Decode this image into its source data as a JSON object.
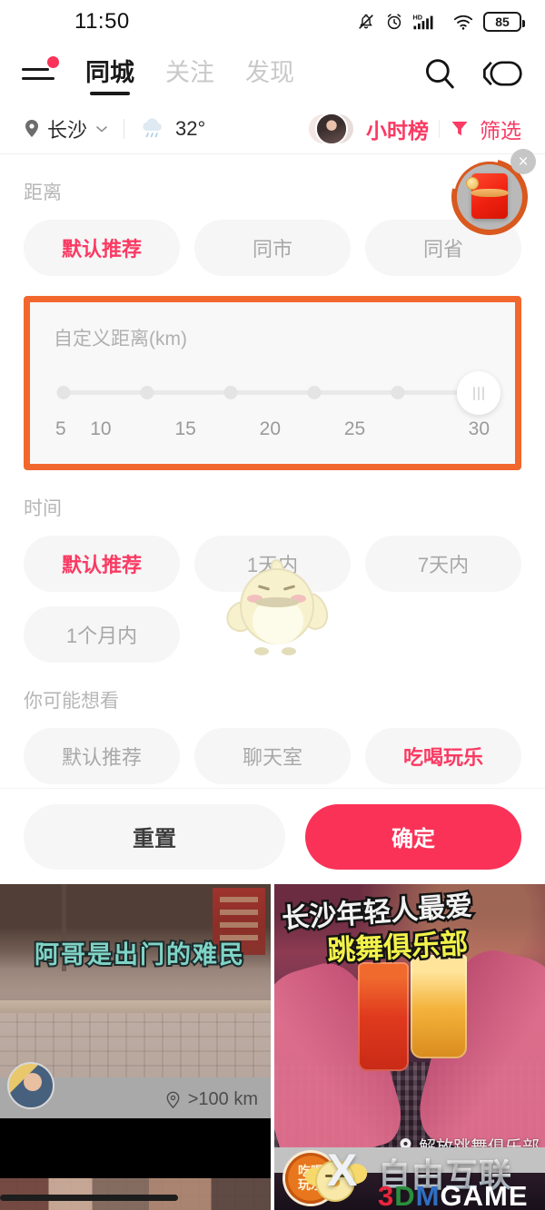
{
  "status_bar": {
    "time": "11:50",
    "battery_level": "85",
    "icons": [
      "bell-muted-icon",
      "alarm-icon",
      "hd-icon",
      "signal-icon",
      "wifi-icon",
      "battery-icon"
    ]
  },
  "top_nav": {
    "menu_icon": "hamburger-menu-icon",
    "has_badge": true,
    "tabs": [
      {
        "label": "同城",
        "active": true
      },
      {
        "label": "关注",
        "active": false
      },
      {
        "label": "发现",
        "active": false
      }
    ],
    "search_icon": "search-icon",
    "live_icon": "live-video-icon"
  },
  "location_bar": {
    "pin_icon": "location-pin-icon",
    "city": "长沙",
    "chevron_icon": "chevron-down-icon",
    "weather_icon": "rain-cloud-icon",
    "temperature": "32°",
    "hot_list_label": "小时榜",
    "filter_icon": "funnel-icon",
    "filter_label": "筛选"
  },
  "floating_packet": {
    "name": "red-packet-icon",
    "close_icon": "close-icon",
    "ring_color": "#d9591f",
    "packet_color": "#ef2010"
  },
  "filter_panel": {
    "distance": {
      "title": "距离",
      "options": [
        {
          "label": "默认推荐",
          "selected": true
        },
        {
          "label": "同市",
          "selected": false
        },
        {
          "label": "同省",
          "selected": false
        }
      ]
    },
    "custom_distance": {
      "label": "自定义距离(km)",
      "ticks": [
        "5",
        "10",
        "15",
        "20",
        "25",
        "30"
      ],
      "value": "30",
      "highlight_color": "#f2672e",
      "thumb_icon": "slider-handle-icon"
    },
    "time": {
      "title": "时间",
      "options": [
        {
          "label": "默认推荐",
          "selected": true
        },
        {
          "label": "1天内",
          "selected": false
        },
        {
          "label": "7天内",
          "selected": false
        },
        {
          "label": "1个月内",
          "selected": false
        }
      ]
    },
    "interests": {
      "title": "你可能想看",
      "options": [
        {
          "label": "默认推荐",
          "selected": false
        },
        {
          "label": "聊天室",
          "selected": false
        },
        {
          "label": "吃喝玩乐",
          "selected": true
        }
      ]
    },
    "actions": {
      "reset_label": "重置",
      "confirm_label": "确定",
      "confirm_color": "#fa3257"
    },
    "accent_color": "#fa3a63"
  },
  "feed": {
    "cards": [
      {
        "caption": "阿哥是出门的难民",
        "distance_icon": "location-pin-icon",
        "distance": ">100  km",
        "avatar": "user-avatar"
      },
      {
        "caption_line1": "长沙年轻人最爱",
        "caption_line2": "跳舞俱乐部",
        "poi_icon": "location-pin-icon",
        "poi": "解放跳舞俱乐部",
        "badge_line1": "吃喝",
        "badge_line2": "玩乐"
      }
    ]
  },
  "watermark": {
    "mascot": "chick-mascot-icon",
    "x_logo": "X",
    "site_cn": "自由互联",
    "site_en_parts": [
      "3",
      "D",
      "M",
      "G",
      "A",
      "M",
      "E"
    ]
  }
}
